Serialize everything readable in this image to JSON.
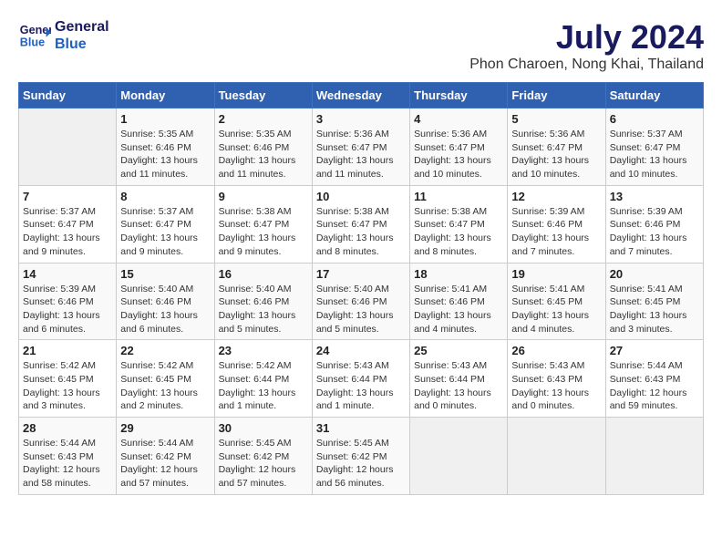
{
  "header": {
    "logo_line1": "General",
    "logo_line2": "Blue",
    "month": "July 2024",
    "location": "Phon Charoen, Nong Khai, Thailand"
  },
  "weekdays": [
    "Sunday",
    "Monday",
    "Tuesday",
    "Wednesday",
    "Thursday",
    "Friday",
    "Saturday"
  ],
  "weeks": [
    [
      {
        "day": "",
        "empty": true
      },
      {
        "day": "1",
        "sunrise": "Sunrise: 5:35 AM",
        "sunset": "Sunset: 6:46 PM",
        "daylight": "Daylight: 13 hours and 11 minutes."
      },
      {
        "day": "2",
        "sunrise": "Sunrise: 5:35 AM",
        "sunset": "Sunset: 6:46 PM",
        "daylight": "Daylight: 13 hours and 11 minutes."
      },
      {
        "day": "3",
        "sunrise": "Sunrise: 5:36 AM",
        "sunset": "Sunset: 6:47 PM",
        "daylight": "Daylight: 13 hours and 11 minutes."
      },
      {
        "day": "4",
        "sunrise": "Sunrise: 5:36 AM",
        "sunset": "Sunset: 6:47 PM",
        "daylight": "Daylight: 13 hours and 10 minutes."
      },
      {
        "day": "5",
        "sunrise": "Sunrise: 5:36 AM",
        "sunset": "Sunset: 6:47 PM",
        "daylight": "Daylight: 13 hours and 10 minutes."
      },
      {
        "day": "6",
        "sunrise": "Sunrise: 5:37 AM",
        "sunset": "Sunset: 6:47 PM",
        "daylight": "Daylight: 13 hours and 10 minutes."
      }
    ],
    [
      {
        "day": "7",
        "sunrise": "Sunrise: 5:37 AM",
        "sunset": "Sunset: 6:47 PM",
        "daylight": "Daylight: 13 hours and 9 minutes."
      },
      {
        "day": "8",
        "sunrise": "Sunrise: 5:37 AM",
        "sunset": "Sunset: 6:47 PM",
        "daylight": "Daylight: 13 hours and 9 minutes."
      },
      {
        "day": "9",
        "sunrise": "Sunrise: 5:38 AM",
        "sunset": "Sunset: 6:47 PM",
        "daylight": "Daylight: 13 hours and 9 minutes."
      },
      {
        "day": "10",
        "sunrise": "Sunrise: 5:38 AM",
        "sunset": "Sunset: 6:47 PM",
        "daylight": "Daylight: 13 hours and 8 minutes."
      },
      {
        "day": "11",
        "sunrise": "Sunrise: 5:38 AM",
        "sunset": "Sunset: 6:47 PM",
        "daylight": "Daylight: 13 hours and 8 minutes."
      },
      {
        "day": "12",
        "sunrise": "Sunrise: 5:39 AM",
        "sunset": "Sunset: 6:46 PM",
        "daylight": "Daylight: 13 hours and 7 minutes."
      },
      {
        "day": "13",
        "sunrise": "Sunrise: 5:39 AM",
        "sunset": "Sunset: 6:46 PM",
        "daylight": "Daylight: 13 hours and 7 minutes."
      }
    ],
    [
      {
        "day": "14",
        "sunrise": "Sunrise: 5:39 AM",
        "sunset": "Sunset: 6:46 PM",
        "daylight": "Daylight: 13 hours and 6 minutes."
      },
      {
        "day": "15",
        "sunrise": "Sunrise: 5:40 AM",
        "sunset": "Sunset: 6:46 PM",
        "daylight": "Daylight: 13 hours and 6 minutes."
      },
      {
        "day": "16",
        "sunrise": "Sunrise: 5:40 AM",
        "sunset": "Sunset: 6:46 PM",
        "daylight": "Daylight: 13 hours and 5 minutes."
      },
      {
        "day": "17",
        "sunrise": "Sunrise: 5:40 AM",
        "sunset": "Sunset: 6:46 PM",
        "daylight": "Daylight: 13 hours and 5 minutes."
      },
      {
        "day": "18",
        "sunrise": "Sunrise: 5:41 AM",
        "sunset": "Sunset: 6:46 PM",
        "daylight": "Daylight: 13 hours and 4 minutes."
      },
      {
        "day": "19",
        "sunrise": "Sunrise: 5:41 AM",
        "sunset": "Sunset: 6:45 PM",
        "daylight": "Daylight: 13 hours and 4 minutes."
      },
      {
        "day": "20",
        "sunrise": "Sunrise: 5:41 AM",
        "sunset": "Sunset: 6:45 PM",
        "daylight": "Daylight: 13 hours and 3 minutes."
      }
    ],
    [
      {
        "day": "21",
        "sunrise": "Sunrise: 5:42 AM",
        "sunset": "Sunset: 6:45 PM",
        "daylight": "Daylight: 13 hours and 3 minutes."
      },
      {
        "day": "22",
        "sunrise": "Sunrise: 5:42 AM",
        "sunset": "Sunset: 6:45 PM",
        "daylight": "Daylight: 13 hours and 2 minutes."
      },
      {
        "day": "23",
        "sunrise": "Sunrise: 5:42 AM",
        "sunset": "Sunset: 6:44 PM",
        "daylight": "Daylight: 13 hours and 1 minute."
      },
      {
        "day": "24",
        "sunrise": "Sunrise: 5:43 AM",
        "sunset": "Sunset: 6:44 PM",
        "daylight": "Daylight: 13 hours and 1 minute."
      },
      {
        "day": "25",
        "sunrise": "Sunrise: 5:43 AM",
        "sunset": "Sunset: 6:44 PM",
        "daylight": "Daylight: 13 hours and 0 minutes."
      },
      {
        "day": "26",
        "sunrise": "Sunrise: 5:43 AM",
        "sunset": "Sunset: 6:43 PM",
        "daylight": "Daylight: 13 hours and 0 minutes."
      },
      {
        "day": "27",
        "sunrise": "Sunrise: 5:44 AM",
        "sunset": "Sunset: 6:43 PM",
        "daylight": "Daylight: 12 hours and 59 minutes."
      }
    ],
    [
      {
        "day": "28",
        "sunrise": "Sunrise: 5:44 AM",
        "sunset": "Sunset: 6:43 PM",
        "daylight": "Daylight: 12 hours and 58 minutes."
      },
      {
        "day": "29",
        "sunrise": "Sunrise: 5:44 AM",
        "sunset": "Sunset: 6:42 PM",
        "daylight": "Daylight: 12 hours and 57 minutes."
      },
      {
        "day": "30",
        "sunrise": "Sunrise: 5:45 AM",
        "sunset": "Sunset: 6:42 PM",
        "daylight": "Daylight: 12 hours and 57 minutes."
      },
      {
        "day": "31",
        "sunrise": "Sunrise: 5:45 AM",
        "sunset": "Sunset: 6:42 PM",
        "daylight": "Daylight: 12 hours and 56 minutes."
      },
      {
        "day": "",
        "empty": true
      },
      {
        "day": "",
        "empty": true
      },
      {
        "day": "",
        "empty": true
      }
    ]
  ]
}
